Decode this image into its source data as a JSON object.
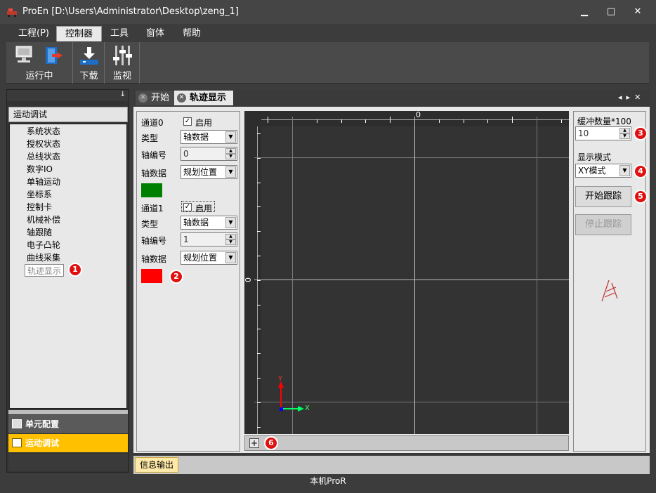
{
  "window": {
    "title": "ProEn [D:\\Users\\Administrator\\Desktop\\zeng_1]",
    "min": "▁",
    "max": "□",
    "close": "✕"
  },
  "menu": [
    "工程(P)",
    "控制器",
    "工具",
    "窗体",
    "帮助"
  ],
  "ribbon": {
    "groups": [
      {
        "label": "运行中"
      },
      {
        "label": "下载"
      },
      {
        "label": "监视"
      }
    ]
  },
  "left_panel": {
    "pin": "↓",
    "title": "运动调试",
    "tree": [
      "系统状态",
      "授权状态",
      "总线状态",
      "数字IO",
      "单轴运动",
      "坐标系",
      "控制卡",
      "机械补偿",
      "轴跟随",
      "电子凸轮",
      "曲线采集",
      "轨迹显示"
    ],
    "selected": "轨迹显示",
    "sections": [
      "单元配置",
      "运动调试"
    ]
  },
  "tabs": [
    {
      "label": "开始"
    },
    {
      "label": "轨迹显示"
    }
  ],
  "tab_nav": {
    "prev": "◂",
    "next": "▸",
    "close": "✕"
  },
  "channels": [
    {
      "name": "通道0",
      "enable_label": "启用",
      "enabled": true,
      "type_label": "类型",
      "type_value": "轴数据",
      "axis_no_label": "轴编号",
      "axis_no_value": "0",
      "axis_data_label": "轴数据",
      "axis_data_value": "规划位置",
      "color": "#008000"
    },
    {
      "name": "通道1",
      "enable_label": "启用",
      "enabled": true,
      "type_label": "类型",
      "type_value": "轴数据",
      "axis_no_label": "轴编号",
      "axis_no_value": "1",
      "axis_data_label": "轴数据",
      "axis_data_value": "规划位置",
      "color": "#ff0000"
    }
  ],
  "plot": {
    "x_zero": "0",
    "y_zero": "0",
    "axis_x": "X",
    "axis_y": "Y",
    "add": "+"
  },
  "right_panel": {
    "buffer_label": "缓冲数量*100",
    "buffer_value": "10",
    "mode_label": "显示模式",
    "mode_value": "XY模式",
    "start_button": "开始跟踪",
    "stop_button": "停止跟踪"
  },
  "badges": [
    "1",
    "2",
    "3",
    "4",
    "5",
    "6"
  ],
  "bottom_tab": "信息输出",
  "status": "本机ProR",
  "colors": {
    "accent": "#ffc000",
    "badge": "#e01010"
  }
}
